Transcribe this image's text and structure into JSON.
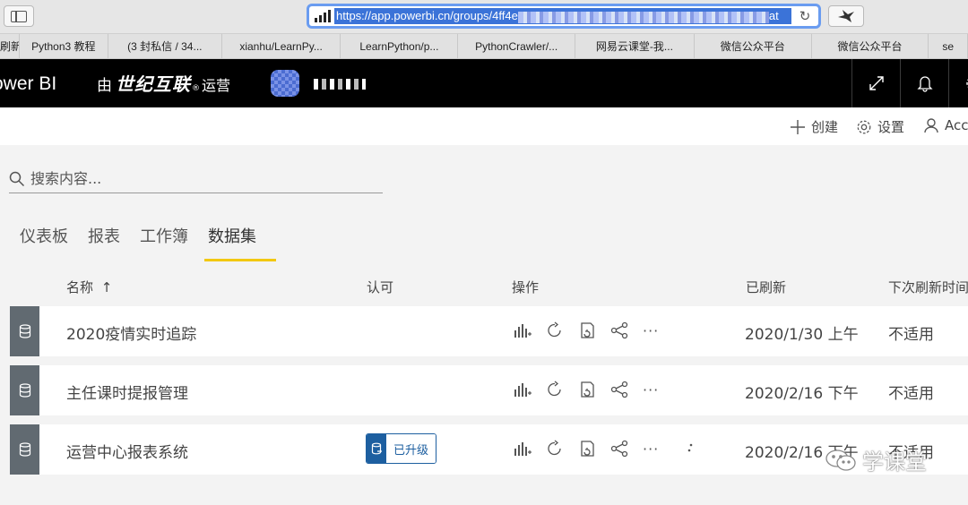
{
  "browser": {
    "url_visible": "https://app.powerbi.cn/groups/4ff4e",
    "url_tail": "at"
  },
  "bookmarks": [
    {
      "label": "刷新",
      "width": 22
    },
    {
      "label": "Python3 教程",
      "width": 100
    },
    {
      "label": "(3 封私信 / 34...",
      "width": 128
    },
    {
      "label": "xianhu/LearnPy...",
      "width": 134
    },
    {
      "label": "LearnPython/p...",
      "width": 132
    },
    {
      "label": "PythonCrawler/...",
      "width": 132
    },
    {
      "label": "网易云课堂-我...",
      "width": 134
    },
    {
      "label": "微信公众平台",
      "width": 132
    },
    {
      "label": "微信公众平台",
      "width": 132
    },
    {
      "label": "se",
      "width": 44
    }
  ],
  "header": {
    "brand": "ower BI",
    "operator_pre": "由",
    "operator_name": "世纪互联",
    "operator_reg": "®",
    "operator_post": "运营"
  },
  "actions": {
    "create": "创建",
    "settings": "设置",
    "account": "Acc"
  },
  "search": {
    "placeholder": "搜索内容..."
  },
  "tabs": [
    {
      "label": "仪表板",
      "active": false
    },
    {
      "label": "报表",
      "active": false
    },
    {
      "label": "工作簿",
      "active": false
    },
    {
      "label": "数据集",
      "active": true
    }
  ],
  "columns": {
    "name": "名称",
    "sort": "↑",
    "endorsement": "认可",
    "actions": "操作",
    "refreshed": "已刷新",
    "next_refresh": "下次刷新时间"
  },
  "rows": [
    {
      "name": "2020疫情实时追踪",
      "refreshed": "2020/1/30 上午",
      "next": "不适用",
      "endorsement": ""
    },
    {
      "name": "主任课时提报管理",
      "refreshed": "2020/2/16 下午",
      "next": "不适用",
      "endorsement": ""
    },
    {
      "name": "运营中心报表系统",
      "refreshed": "2020/2/16 下午",
      "next": "不适用",
      "endorsement": "已升级"
    }
  ],
  "ops_more": "···",
  "watermark": "学课堂",
  "colors": {
    "accent_tab": "#f2c811",
    "header_bg": "#000000",
    "stripe": "#616a71",
    "endorse": "#1d5fa0"
  }
}
